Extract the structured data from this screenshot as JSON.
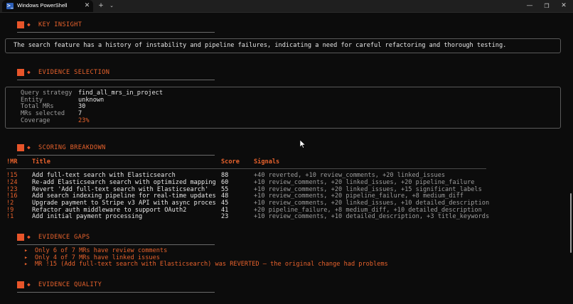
{
  "window": {
    "tab_title": "Windows PowerShell",
    "tab_icon": "powershell-icon",
    "tab_close": "✕",
    "new_tab": "+",
    "tab_dropdown": "⌄",
    "minimize": "—",
    "maximize": "❐",
    "close": "✕"
  },
  "accent_color": "#e8622c",
  "sections": {
    "key_insight": {
      "title": "KEY INSIGHT",
      "text": "The search feature has a history of instability and pipeline failures, indicating a need for careful refactoring and thorough testing."
    },
    "evidence_selection": {
      "title": "EVIDENCE SELECTION",
      "rows": [
        {
          "label": "Query strategy",
          "value": "find_all_mrs_in_project"
        },
        {
          "label": "Entity",
          "value": "unknown"
        },
        {
          "label": "Total MRs",
          "value": "30"
        },
        {
          "label": "MRs selected",
          "value": "7"
        },
        {
          "label": "Coverage",
          "value": "23%"
        }
      ]
    },
    "scoring": {
      "title": "SCORING BREAKDOWN",
      "headers": {
        "mr": "!MR",
        "title": "Title",
        "score": "Score",
        "signals": "Signals"
      },
      "rows": [
        {
          "mr": "!15",
          "title": "Add full-text search with Elasticsearch",
          "score": "88",
          "signals": "+40 reverted, +10 review_comments, +20 linked_issues"
        },
        {
          "mr": "!24",
          "title": "Re-add Elasticsearch search with optimized mapping",
          "score": "60",
          "signals": "+10 review_comments, +20 linked_issues, +20 pipeline_failure"
        },
        {
          "mr": "!23",
          "title": "Revert 'Add full-text search with Elasticsearch'",
          "score": "55",
          "signals": "+10 review_comments, +20 linked_issues, +15 significant_labels"
        },
        {
          "mr": "!16",
          "title": "Add search indexing pipeline for real-time updates",
          "score": "48",
          "signals": "+10 review_comments, +20 pipeline_failure, +8 medium_diff"
        },
        {
          "mr": "!2",
          "title": "Upgrade payment to Stripe v3 API with async proces",
          "score": "45",
          "signals": "+10 review_comments, +20 linked_issues, +10 detailed_description"
        },
        {
          "mr": "!9",
          "title": "Refactor auth middleware to support OAuth2",
          "score": "41",
          "signals": "+20 pipeline_failure, +8 medium_diff, +10 detailed_description"
        },
        {
          "mr": "!1",
          "title": "Add initial payment processing",
          "score": "23",
          "signals": "+10 review_comments, +10 detailed_description, +3 title_keywords"
        }
      ]
    },
    "evidence_gaps": {
      "title": "EVIDENCE GAPS",
      "bullet": "▸",
      "items": [
        "Only 6 of 7 MRs have review comments",
        "Only 4 of 7 MRs have linked issues",
        "MR !15 (Add full-text search with Elasticsearch) was REVERTED — the original change had problems"
      ]
    },
    "evidence_quality": {
      "title": "EVIDENCE QUALITY"
    }
  },
  "header_glyph": "◆"
}
